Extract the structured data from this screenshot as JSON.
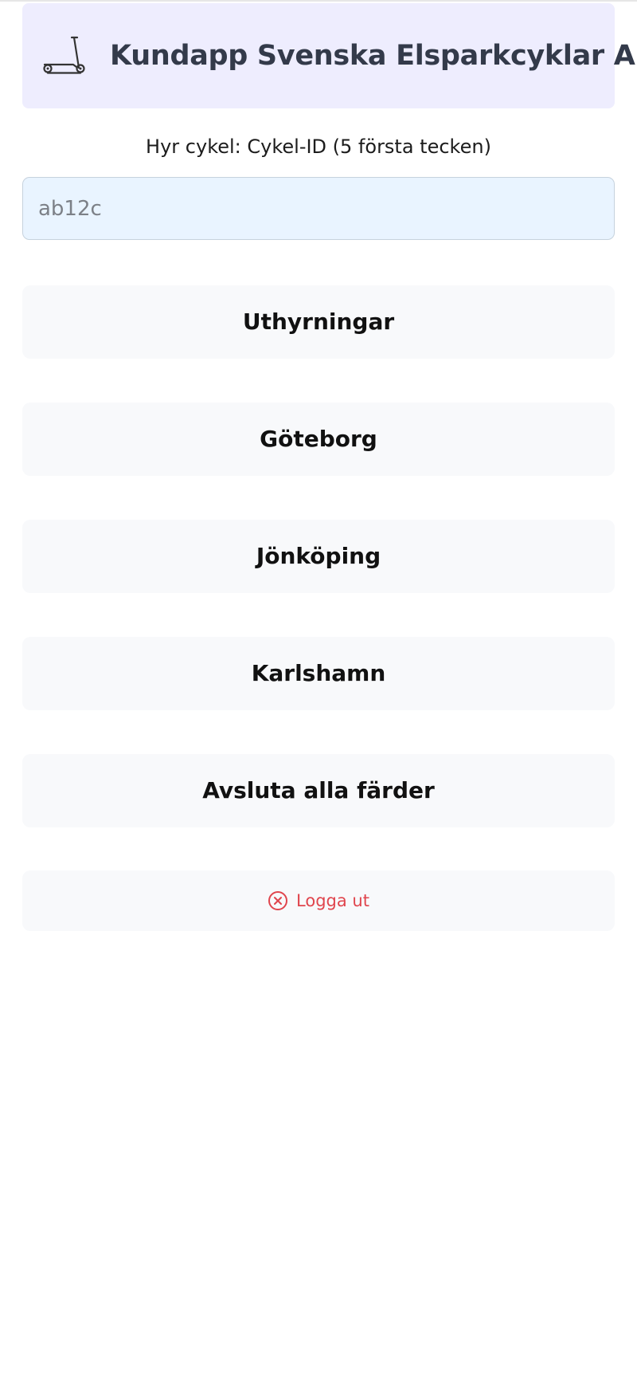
{
  "header": {
    "logo_icon": "scooter-icon",
    "title": "Kundapp Svenska Elsparkcyklar AB"
  },
  "rent": {
    "label": "Hyr cykel: Cykel-ID (5 första tecken)",
    "placeholder": "ab12c",
    "value": ""
  },
  "nav": {
    "rentals_label": "Uthyrningar",
    "city_1_label": "Göteborg",
    "city_2_label": "Jönköping",
    "city_3_label": "Karlshamn",
    "end_all_label": "Avsluta alla färder"
  },
  "logout": {
    "icon": "close-circle-icon",
    "label": "Logga ut"
  },
  "colors": {
    "header_bg": "#eeedfe",
    "input_bg": "#e9f4ff",
    "button_bg": "#f8f9fb",
    "logout_red": "#e0454d"
  }
}
